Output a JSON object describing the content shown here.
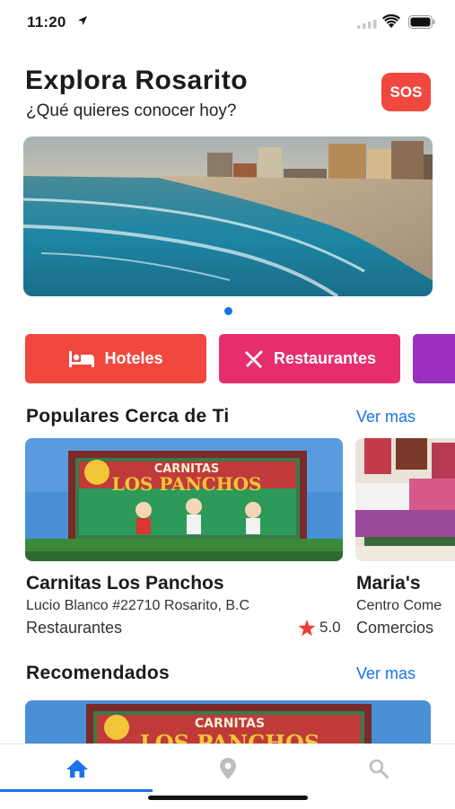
{
  "status": {
    "time": "11:20"
  },
  "header": {
    "title": "Explora Rosarito",
    "subtitle": "¿Qué quieres conocer hoy?",
    "sos_label": "SOS"
  },
  "carousel": {
    "page_count": 1,
    "active_index": 0
  },
  "categories": [
    {
      "label": "Hoteles",
      "icon": "bed-icon",
      "color": "#f0483e"
    },
    {
      "label": "Restaurantes",
      "icon": "fork-knife-icon",
      "color": "#e62f6a"
    },
    {
      "label": "",
      "icon": "",
      "color": "#9b2fc0"
    }
  ],
  "popular": {
    "title": "Populares Cerca de Ti",
    "more_label": "Ver mas",
    "items": [
      {
        "name": "Carnitas Los Panchos",
        "address": "Lucio Blanco #22710 Rosarito, B.C",
        "category": "Restaurantes",
        "rating": "5.0",
        "sign_top": "CARNITAS",
        "sign_main": "LOS PANCHOS"
      },
      {
        "name": "Maria's",
        "address": "Centro Come",
        "category": "Comercios"
      }
    ]
  },
  "recommended": {
    "title": "Recomendados",
    "more_label": "Ver mas",
    "sign_top": "CARNITAS",
    "sign_main": "LOS PANCHOS"
  },
  "tabbar": {
    "items": [
      {
        "icon": "home-icon",
        "active": true
      },
      {
        "icon": "location-pin-icon",
        "active": false
      },
      {
        "icon": "search-icon",
        "active": false
      }
    ],
    "accent": "#1a73e8"
  }
}
